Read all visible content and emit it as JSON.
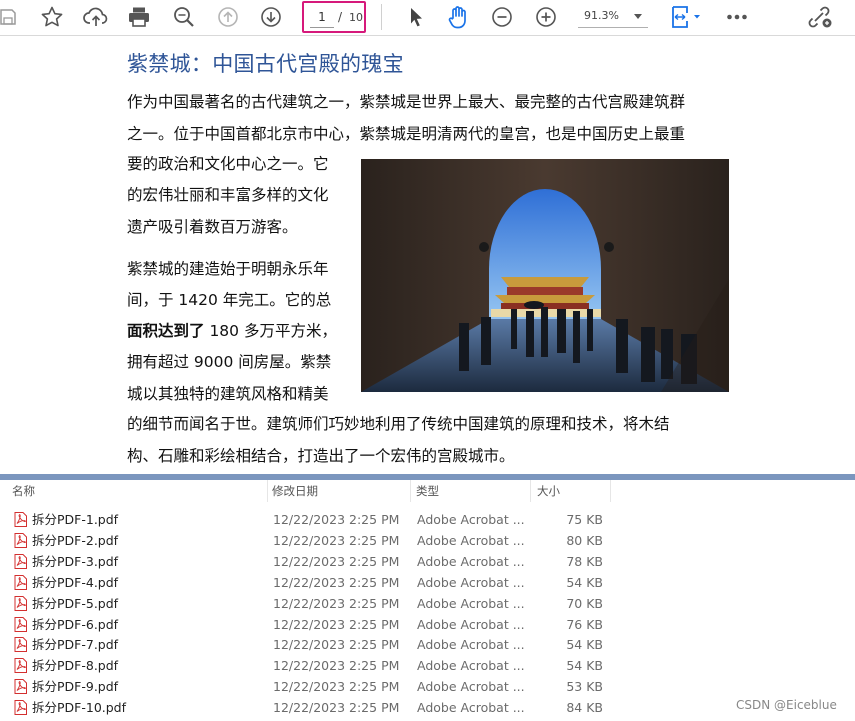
{
  "toolbar": {
    "icons": [
      "save-icon",
      "bookmark-star-icon",
      "cloud-upload-icon",
      "print-icon",
      "zoom-search-icon",
      "page-up-icon",
      "page-down-icon",
      "select-pointer-icon",
      "hand-tool-icon",
      "zoom-out-icon",
      "zoom-in-icon",
      "fit-page-icon",
      "more-options-icon",
      "share-link-icon"
    ],
    "page_current": "1",
    "page_separator": "/",
    "page_total": "10",
    "zoom_level": "91.3%"
  },
  "document": {
    "title": "紫禁城：中国古代宫殿的瑰宝",
    "lines": {
      "l1": "作为中国最著名的古代建筑之一，紫禁城是世界上最大、最完整的古代宫殿建筑群",
      "l2": "之一。位于中国首都北京市中心，紫禁城是明清两代的皇宫，也是中国历史上最重",
      "l3": "要的政治和文化中心之一。它",
      "l4": "的宏伟壮丽和丰富多样的文化",
      "l5": "遗产吸引着数百万游客。",
      "l6": "紫禁城的建造始于明朝永乐年",
      "l7": "间，于 1420 年完工。它的总",
      "l8_bold": "面积达到了",
      "l8_rest": " 180 多万平方米，",
      "l9": "拥有超过 9000 间房屋。紫禁",
      "l10": "城以其独特的建筑风格和精美",
      "l11": "的细节而闻名于世。建筑师们巧妙地利用了传统中国建筑的原理和技术，将木结",
      "l12": "构、石雕和彩绘相结合，打造出了一个宏伟的宫殿城市。"
    }
  },
  "file_list": {
    "headers": {
      "name": "名称",
      "date": "修改日期",
      "type": "类型",
      "size": "大小"
    },
    "rows": [
      {
        "name": "拆分PDF-1.pdf",
        "date": "12/22/2023 2:25 PM",
        "type": "Adobe Acrobat ...",
        "size": "75 KB"
      },
      {
        "name": "拆分PDF-2.pdf",
        "date": "12/22/2023 2:25 PM",
        "type": "Adobe Acrobat ...",
        "size": "80 KB"
      },
      {
        "name": "拆分PDF-3.pdf",
        "date": "12/22/2023 2:25 PM",
        "type": "Adobe Acrobat ...",
        "size": "78 KB"
      },
      {
        "name": "拆分PDF-4.pdf",
        "date": "12/22/2023 2:25 PM",
        "type": "Adobe Acrobat ...",
        "size": "54 KB"
      },
      {
        "name": "拆分PDF-5.pdf",
        "date": "12/22/2023 2:25 PM",
        "type": "Adobe Acrobat ...",
        "size": "70 KB"
      },
      {
        "name": "拆分PDF-6.pdf",
        "date": "12/22/2023 2:25 PM",
        "type": "Adobe Acrobat ...",
        "size": "76 KB"
      },
      {
        "name": "拆分PDF-7.pdf",
        "date": "12/22/2023 2:25 PM",
        "type": "Adobe Acrobat ...",
        "size": "54 KB"
      },
      {
        "name": "拆分PDF-8.pdf",
        "date": "12/22/2023 2:25 PM",
        "type": "Adobe Acrobat ...",
        "size": "54 KB"
      },
      {
        "name": "拆分PDF-9.pdf",
        "date": "12/22/2023 2:25 PM",
        "type": "Adobe Acrobat ...",
        "size": "53 KB"
      },
      {
        "name": "拆分PDF-10.pdf",
        "date": "12/22/2023 2:25 PM",
        "type": "Adobe Acrobat ...",
        "size": "84 KB"
      }
    ]
  },
  "watermark": "CSDN @Eiceblue",
  "colors": {
    "title_blue": "#2f5597",
    "highlight_pink": "#d6197b",
    "divider_blue": "#7b96be",
    "pdf_red": "#d32f2f",
    "hand_tool_blue": "#1a73e8"
  }
}
